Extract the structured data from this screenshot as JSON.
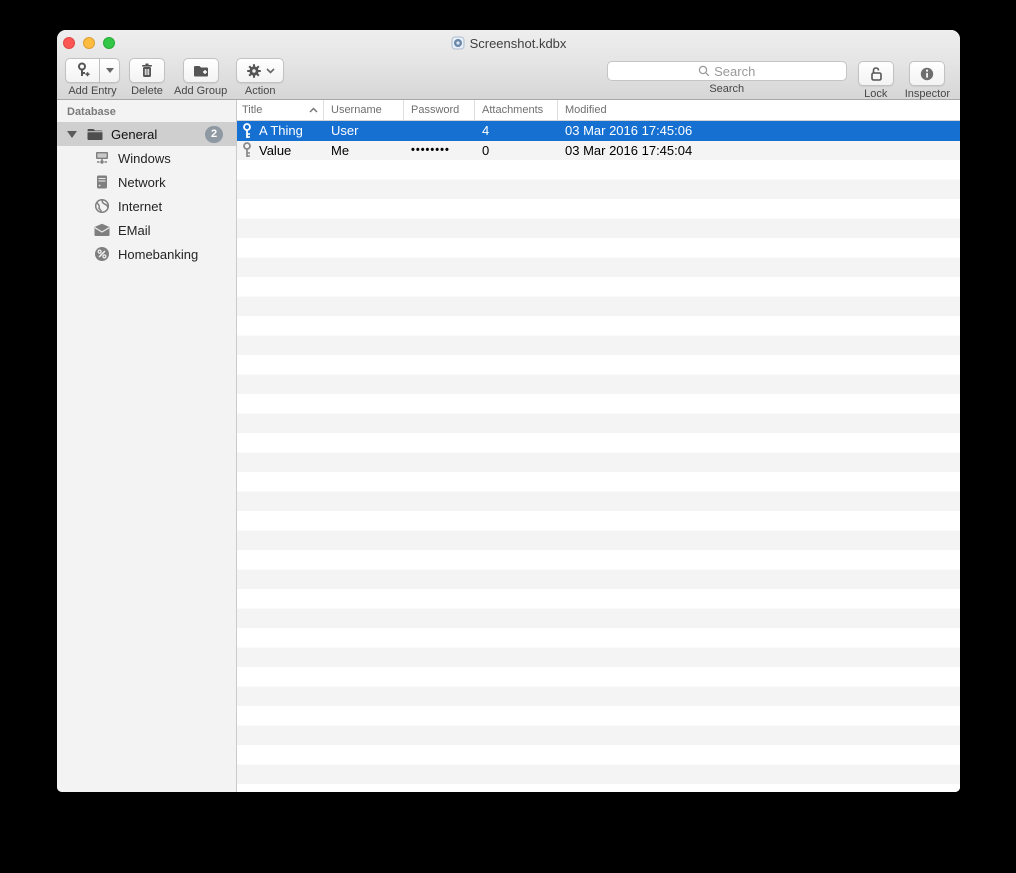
{
  "window": {
    "title": "Screenshot.kdbx"
  },
  "toolbar": {
    "add_entry_label": "Add Entry",
    "delete_label": "Delete",
    "add_group_label": "Add Group",
    "action_label": "Action",
    "search_placeholder": "Search",
    "search_label": "Search",
    "lock_label": "Lock",
    "inspector_label": "Inspector"
  },
  "sidebar": {
    "header": "Database",
    "root": {
      "label": "General",
      "badge": "2"
    },
    "items": [
      {
        "label": "Windows",
        "icon": "windows-network-icon"
      },
      {
        "label": "Network",
        "icon": "server-icon"
      },
      {
        "label": "Internet",
        "icon": "globe-icon"
      },
      {
        "label": "EMail",
        "icon": "envelope-icon"
      },
      {
        "label": "Homebanking",
        "icon": "percent-icon"
      }
    ]
  },
  "table": {
    "columns": [
      "Title",
      "Username",
      "Password",
      "Attachments",
      "Modified"
    ],
    "sort_column": "Title",
    "sort_direction": "ascending",
    "rows": [
      {
        "title": "A Thing",
        "username": "User",
        "password": "",
        "attachments": "4",
        "modified": "03 Mar 2016 17:45:06",
        "selected": true
      },
      {
        "title": "Value",
        "username": "Me",
        "password": "••••••••",
        "attachments": "0",
        "modified": "03 Mar 2016 17:45:04",
        "selected": false
      }
    ]
  },
  "colors": {
    "selection_blue": "#1570d2",
    "alt_row_gray": "#f4f4f4",
    "badge_gray": "#8f99a4",
    "sidebar_selection": "#cfcfcf"
  }
}
